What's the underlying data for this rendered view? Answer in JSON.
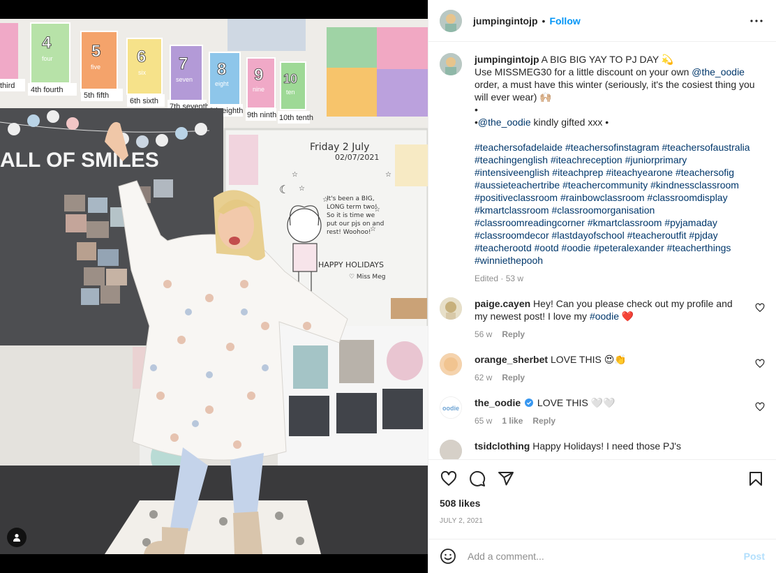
{
  "post": {
    "username": "jumpingintojp",
    "follow_label": "Follow",
    "dot": "•",
    "caption_lines": [
      "A BIG BIG YAY TO PJ DAY 💫",
      "Use MISSMEG30 for a little discount on your own",
      "order, a must have this winter (seriously, it's the cosiest thing you will ever wear) 🙌🏼",
      "•",
      "•",
      "kindly gifted xxx •"
    ],
    "mention": "@the_oodie",
    "hashtags": "#teachersofadelaide #teachersofinstagram #teachersofaustralia #teachingenglish #iteachreception #juniorprimary #intensiveenglish #iteachprep #iteachyearone #teachersofig #aussieteachertribe #teachercommunity #kindnessclassroom #positiveclassroom #rainbowclassroom #classroomdisplay #kmartclassroom #classroomorganisation #classroomreadingcorner #kmartclassroom #pyjamaday #classroomdecor #lastdayofschool #teacheroutfit #pjday #teacherootd #ootd #oodie #peteralexander #teacherthings #winniethepooh",
    "caption_meta": "Edited · 53 w",
    "likes": "508 likes",
    "date": "July 2, 2021"
  },
  "comments": [
    {
      "user": "paige.cayen",
      "text": "Hey! Can you please check out my profile and my newest post! I love my",
      "tag": "#oodie",
      "emoji": "❤️",
      "age": "56 w",
      "reply": "Reply"
    },
    {
      "user": "orange_sherbet",
      "text": "LOVE THIS 😍👏",
      "age": "62 w",
      "reply": "Reply"
    },
    {
      "user": "the_oodie",
      "text": "LOVE THIS 🤍🤍",
      "age": "65 w",
      "likes": "1 like",
      "reply": "Reply"
    },
    {
      "user": "tsidclothing",
      "text": "Happy Holidays! I need those PJ's"
    }
  ],
  "add_comment": {
    "placeholder": "Add a comment...",
    "post_label": "Post"
  },
  "photo_text": {
    "date_board": "Friday 2 July",
    "date_num": "02/07/2021",
    "board_msg": "It's been a BIG, LONG term two! So it is time we put our pjs on and rest! Woohoo!",
    "happy": "HAPPY HOLIDAYS",
    "sign": "♡ Miss Meg",
    "wall": "ALL OF SMILES",
    "numbers": [
      "third",
      "4th fourth",
      "5th fifth",
      "6th sixth",
      "7th seventh",
      "8th eighth",
      "9th ninth",
      "10th tenth"
    ],
    "number_cards": [
      "4",
      "5",
      "6",
      "7",
      "8",
      "9",
      "10"
    ],
    "number_words": [
      "four",
      "five",
      "six",
      "seven",
      "eight",
      "nine",
      "ten"
    ]
  },
  "colors": {
    "accent": "#0095f6",
    "link": "#00376b",
    "muted": "#8e8e8e",
    "heart": "#ed4956"
  },
  "icons": [
    "heart-icon",
    "comment-icon",
    "share-icon",
    "bookmark-icon",
    "more-icon",
    "emoji-icon",
    "user-tag-icon"
  ]
}
